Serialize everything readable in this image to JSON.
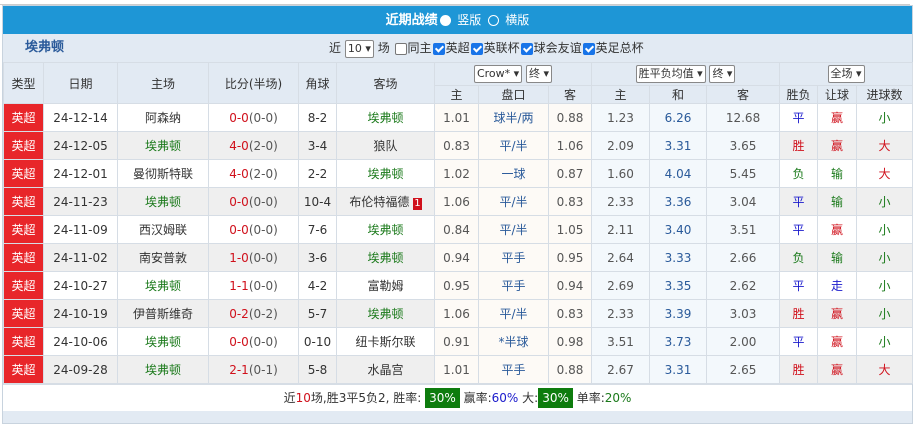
{
  "title": "近期战绩",
  "view_options": [
    "竖版",
    "横版"
  ],
  "team": "埃弗顿",
  "filter": {
    "near": "近",
    "count": "10",
    "games": "场",
    "same_home": "同主",
    "leagues": [
      "英超",
      "英联杯",
      "球会友谊",
      "英足总杯"
    ]
  },
  "headers": {
    "type": "类型",
    "date": "日期",
    "home": "主场",
    "score": "比分(半场)",
    "corner": "角球",
    "away": "客场",
    "ah_company": "Crow*",
    "ah_time": "终",
    "eu_company": "胜平负均值",
    "eu_time": "终",
    "scope": "全场",
    "ah_home": "主",
    "ah_line": "盘口",
    "ah_away": "客",
    "eu_home": "主",
    "eu_draw": "和",
    "eu_away": "客",
    "result": "胜负",
    "handicap": "让球",
    "goals": "进球数"
  },
  "rows": [
    {
      "type": "英超",
      "date": "24-12-14",
      "home": "阿森纳",
      "ft": "0-0",
      "ht": "(0-0)",
      "corner": "8-2",
      "away": "埃弗顿",
      "badge": "",
      "ah_h": "1.01",
      "line": "球半/两",
      "ah_a": "0.88",
      "eu_h": "1.23",
      "eu_d": "6.26",
      "eu_a": "12.68",
      "res": "平",
      "hc": "赢",
      "ou": "小"
    },
    {
      "type": "英超",
      "date": "24-12-05",
      "home": "埃弗顿",
      "ft": "4-0",
      "ht": "(2-0)",
      "corner": "3-4",
      "away": "狼队",
      "badge": "",
      "ah_h": "0.83",
      "line": "平/半",
      "ah_a": "1.06",
      "eu_h": "2.09",
      "eu_d": "3.31",
      "eu_a": "3.65",
      "res": "胜",
      "hc": "赢",
      "ou": "大"
    },
    {
      "type": "英超",
      "date": "24-12-01",
      "home": "曼彻斯特联",
      "ft": "4-0",
      "ht": "(2-0)",
      "corner": "2-2",
      "away": "埃弗顿",
      "badge": "",
      "ah_h": "1.02",
      "line": "一球",
      "ah_a": "0.87",
      "eu_h": "1.60",
      "eu_d": "4.04",
      "eu_a": "5.45",
      "res": "负",
      "hc": "输",
      "ou": "大"
    },
    {
      "type": "英超",
      "date": "24-11-23",
      "home": "埃弗顿",
      "ft": "0-0",
      "ht": "(0-0)",
      "corner": "10-4",
      "away": "布伦特福德",
      "badge": "1",
      "ah_h": "1.06",
      "line": "平/半",
      "ah_a": "0.83",
      "eu_h": "2.33",
      "eu_d": "3.36",
      "eu_a": "3.04",
      "res": "平",
      "hc": "输",
      "ou": "小"
    },
    {
      "type": "英超",
      "date": "24-11-09",
      "home": "西汉姆联",
      "ft": "0-0",
      "ht": "(0-0)",
      "corner": "7-6",
      "away": "埃弗顿",
      "badge": "",
      "ah_h": "0.84",
      "line": "平/半",
      "ah_a": "1.05",
      "eu_h": "2.11",
      "eu_d": "3.40",
      "eu_a": "3.51",
      "res": "平",
      "hc": "赢",
      "ou": "小"
    },
    {
      "type": "英超",
      "date": "24-11-02",
      "home": "南安普敦",
      "ft": "1-0",
      "ht": "(0-0)",
      "corner": "3-6",
      "away": "埃弗顿",
      "badge": "",
      "ah_h": "0.94",
      "line": "平手",
      "ah_a": "0.95",
      "eu_h": "2.64",
      "eu_d": "3.33",
      "eu_a": "2.66",
      "res": "负",
      "hc": "输",
      "ou": "小"
    },
    {
      "type": "英超",
      "date": "24-10-27",
      "home": "埃弗顿",
      "ft": "1-1",
      "ht": "(0-0)",
      "corner": "4-2",
      "away": "富勒姆",
      "badge": "",
      "ah_h": "0.95",
      "line": "平手",
      "ah_a": "0.94",
      "eu_h": "2.69",
      "eu_d": "3.35",
      "eu_a": "2.62",
      "res": "平",
      "hc": "走",
      "ou": "小"
    },
    {
      "type": "英超",
      "date": "24-10-19",
      "home": "伊普斯维奇",
      "ft": "0-2",
      "ht": "(0-2)",
      "corner": "5-7",
      "away": "埃弗顿",
      "badge": "",
      "ah_h": "1.06",
      "line": "平/半",
      "ah_a": "0.83",
      "eu_h": "2.33",
      "eu_d": "3.39",
      "eu_a": "3.03",
      "res": "胜",
      "hc": "赢",
      "ou": "小"
    },
    {
      "type": "英超",
      "date": "24-10-06",
      "home": "埃弗顿",
      "ft": "0-0",
      "ht": "(0-0)",
      "corner": "0-10",
      "away": "纽卡斯尔联",
      "badge": "",
      "ah_h": "0.91",
      "line": "*半球",
      "ah_a": "0.98",
      "eu_h": "3.51",
      "eu_d": "3.73",
      "eu_a": "2.00",
      "res": "平",
      "hc": "赢",
      "ou": "小"
    },
    {
      "type": "英超",
      "date": "24-09-28",
      "home": "埃弗顿",
      "ft": "2-1",
      "ht": "(0-1)",
      "corner": "5-8",
      "away": "水晶宫",
      "badge": "",
      "ah_h": "1.01",
      "line": "平手",
      "ah_a": "0.88",
      "eu_h": "2.67",
      "eu_d": "3.31",
      "eu_a": "2.65",
      "res": "胜",
      "hc": "赢",
      "ou": "大"
    }
  ],
  "summary": {
    "p1": "近",
    "n": "10",
    "p2": "场,胜3平5负2, 胜率:",
    "win": "30%",
    "p3": "赢率:",
    "hwin": "60%",
    "p4": "大:",
    "big": "30%",
    "p5": "单率:",
    "odd": "20%"
  },
  "colors": {
    "title_bar": "#1e96d6",
    "type_badge": "#e8262a",
    "rate_badge": "#0e7c0e",
    "everton": "#1b7a1b"
  }
}
